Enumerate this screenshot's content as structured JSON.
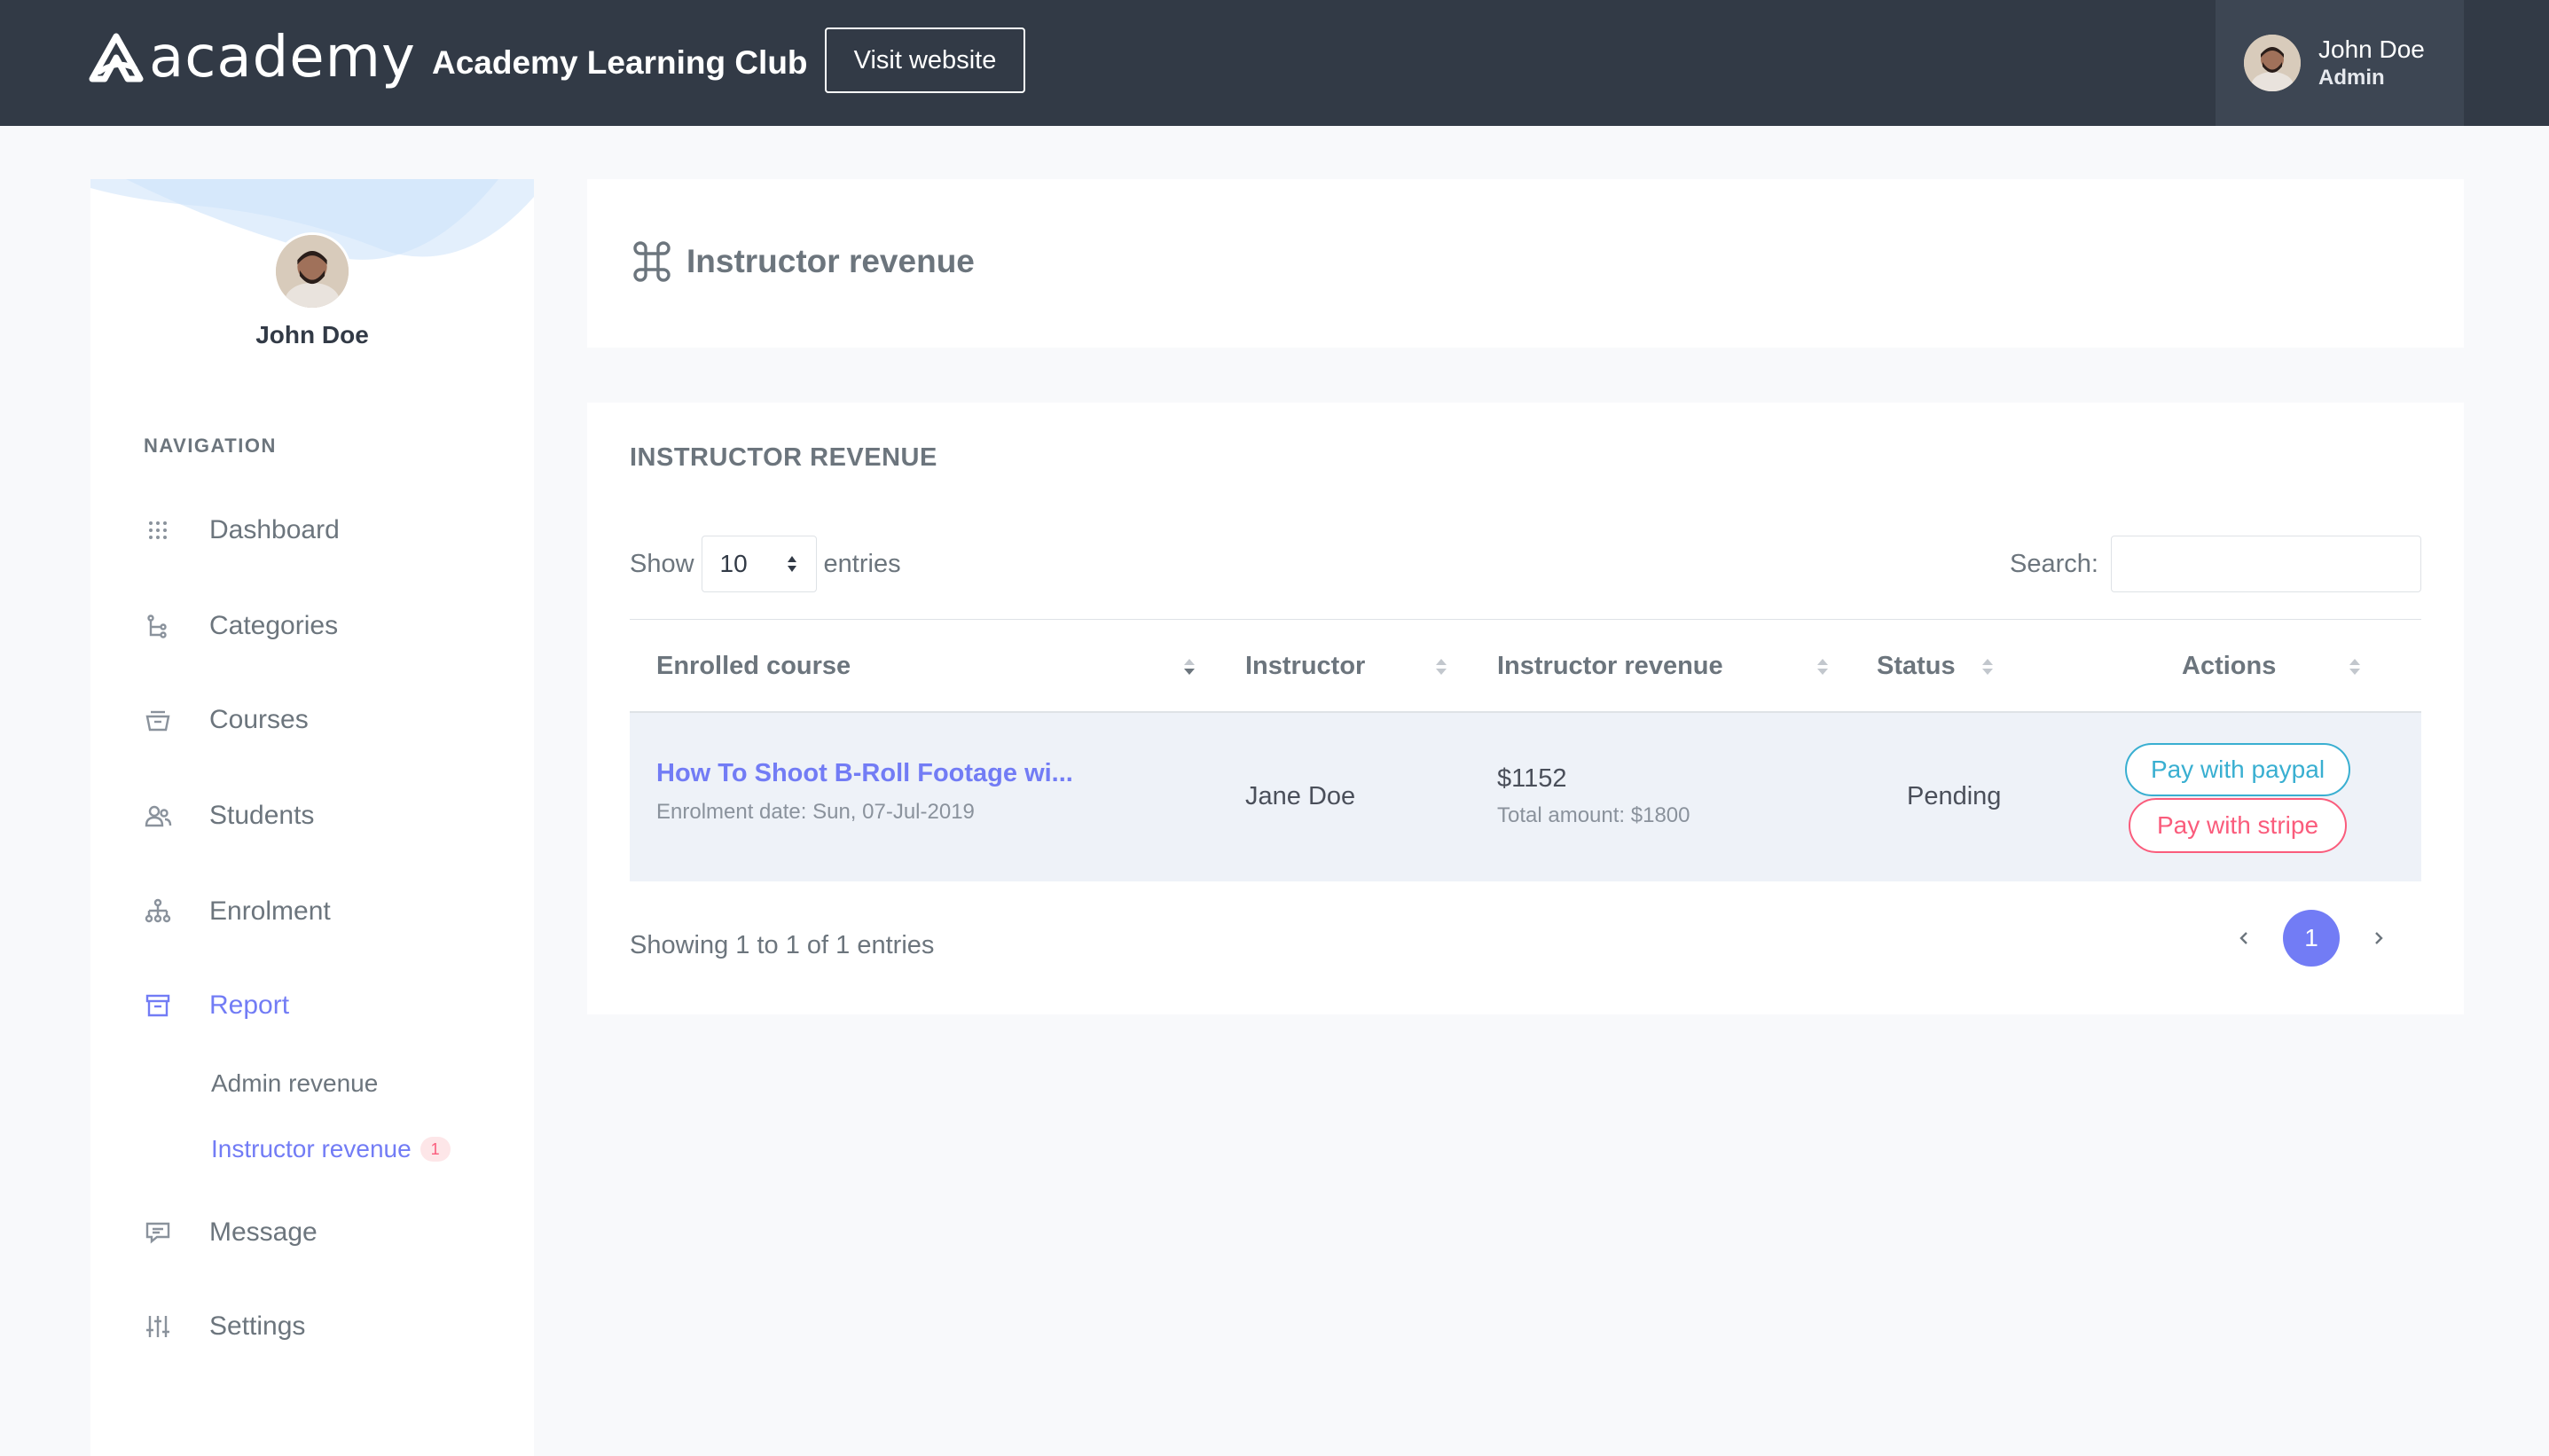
{
  "header": {
    "brand": "academy",
    "club_name": "Academy Learning Club",
    "visit_label": "Visit website",
    "user": {
      "name": "John Doe",
      "role": "Admin"
    }
  },
  "sidebar": {
    "user_name": "John Doe",
    "nav_title": "NAVIGATION",
    "items": [
      {
        "label": "Dashboard",
        "icon": "dashboard-grid-icon"
      },
      {
        "label": "Categories",
        "icon": "categories-tree-icon"
      },
      {
        "label": "Courses",
        "icon": "courses-icon"
      },
      {
        "label": "Students",
        "icon": "students-icon"
      },
      {
        "label": "Enrolment",
        "icon": "enrolment-icon"
      },
      {
        "label": "Report",
        "icon": "report-icon"
      },
      {
        "label": "Message",
        "icon": "message-icon"
      },
      {
        "label": "Settings",
        "icon": "settings-sliders-icon"
      }
    ],
    "report_sub": {
      "admin_revenue": "Admin revenue",
      "instructor_revenue": "Instructor revenue",
      "instructor_badge": "1"
    }
  },
  "page": {
    "title": "Instructor revenue",
    "section_title": "INSTRUCTOR REVENUE",
    "show_label": "Show",
    "entries_value": "10",
    "entries_label": "entries",
    "search_label": "Search:",
    "search_value": "",
    "columns": [
      "Enrolled course",
      "Instructor",
      "Instructor revenue",
      "Status",
      "Actions"
    ],
    "rows": [
      {
        "course": "How To Shoot B-Roll Footage wi...",
        "enrolment_date": "Enrolment date: Sun, 07-Jul-2019",
        "instructor": "Jane Doe",
        "revenue": "$1152",
        "total": "Total amount: $1800",
        "status": "Pending",
        "paypal_label": "Pay with paypal",
        "stripe_label": "Pay with stripe"
      }
    ],
    "showing": "Showing 1 to 1 of 1 entries",
    "current_page": "1"
  },
  "colors": {
    "topbar": "#323a46",
    "primary": "#727cf5",
    "info": "#39afd1",
    "danger": "#fa5c7c",
    "row_highlight": "#eef2f8"
  }
}
